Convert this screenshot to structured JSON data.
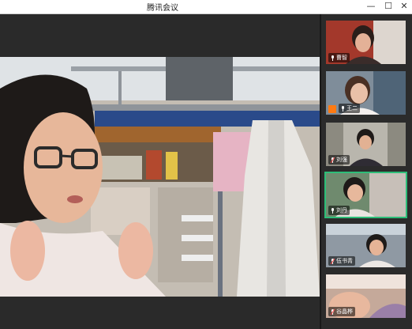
{
  "window": {
    "title": "腾讯会议",
    "controls": {
      "minimize": "—",
      "maximize": "☐",
      "close": "✕"
    }
  },
  "participants": [
    {
      "name": "曹智",
      "muted": false
    },
    {
      "name": "王二",
      "muted": false,
      "badge": "orange-avatar"
    },
    {
      "name": "刘强",
      "muted": true
    },
    {
      "name": "刘丹",
      "muted": false,
      "active": true
    },
    {
      "name": "伍书青",
      "muted": true
    },
    {
      "name": "谷晶桦",
      "muted": true
    }
  ]
}
